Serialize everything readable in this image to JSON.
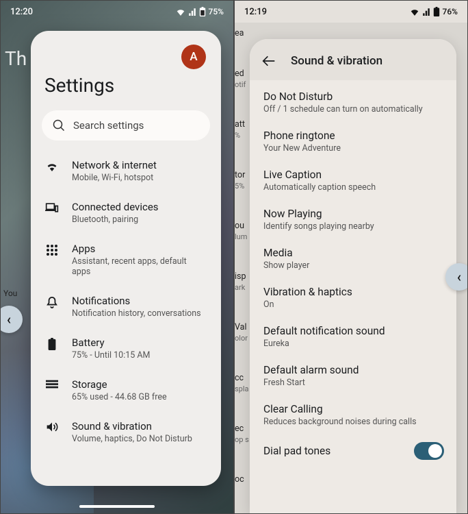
{
  "left": {
    "status": {
      "time": "12:20",
      "battery_text": "75%"
    },
    "bg_peek": "Th",
    "avatar_letter": "A",
    "title": "Settings",
    "search_placeholder": "Search settings",
    "items": [
      {
        "title": "Network & internet",
        "sub": "Mobile, Wi-Fi, hotspot"
      },
      {
        "title": "Connected devices",
        "sub": "Bluetooth, pairing"
      },
      {
        "title": "Apps",
        "sub": "Assistant, recent apps, default apps"
      },
      {
        "title": "Notifications",
        "sub": "Notification history, conversations"
      },
      {
        "title": "Battery",
        "sub": "75% - Until 10:15 AM"
      },
      {
        "title": "Storage",
        "sub": "65% used - 44.68 GB free"
      },
      {
        "title": "Sound & vibration",
        "sub": "Volume, haptics, Do Not Disturb"
      }
    ],
    "nav_arrow": "‹"
  },
  "right": {
    "status": {
      "time": "12:19",
      "battery_text": "76%"
    },
    "header": {
      "title": "Sound & vibration"
    },
    "items": [
      {
        "title": "Do Not Disturb",
        "sub": "Off / 1 schedule can turn on automatically"
      },
      {
        "title": "Phone ringtone",
        "sub": "Your New Adventure"
      },
      {
        "title": "Live Caption",
        "sub": "Automatically caption speech"
      },
      {
        "title": "Now Playing",
        "sub": "Identify songs playing nearby"
      },
      {
        "title": "Media",
        "sub": "Show player"
      },
      {
        "title": "Vibration & haptics",
        "sub": "On"
      },
      {
        "title": "Default notification sound",
        "sub": "Eureka"
      },
      {
        "title": "Default alarm sound",
        "sub": "Fresh Start"
      },
      {
        "title": "Clear Calling",
        "sub": "Reduces background noises during calls"
      },
      {
        "title": "Dial pad tones",
        "toggle": true
      }
    ],
    "nav_arrow": "‹",
    "bg_partials": [
      {
        "t": "ea",
        "s": ""
      },
      {
        "t": "ed",
        "s": "otif"
      },
      {
        "t": "att",
        "s": "%"
      },
      {
        "t": "tor",
        "s": "5%"
      },
      {
        "t": "ou",
        "s": "lum"
      },
      {
        "t": "isp",
        "s": "ark"
      },
      {
        "t": "Val",
        "s": "olor"
      },
      {
        "t": "cc",
        "s": "spla"
      },
      {
        "t": "ec",
        "s": "op s"
      },
      {
        "t": "oc",
        "s": ""
      }
    ]
  }
}
